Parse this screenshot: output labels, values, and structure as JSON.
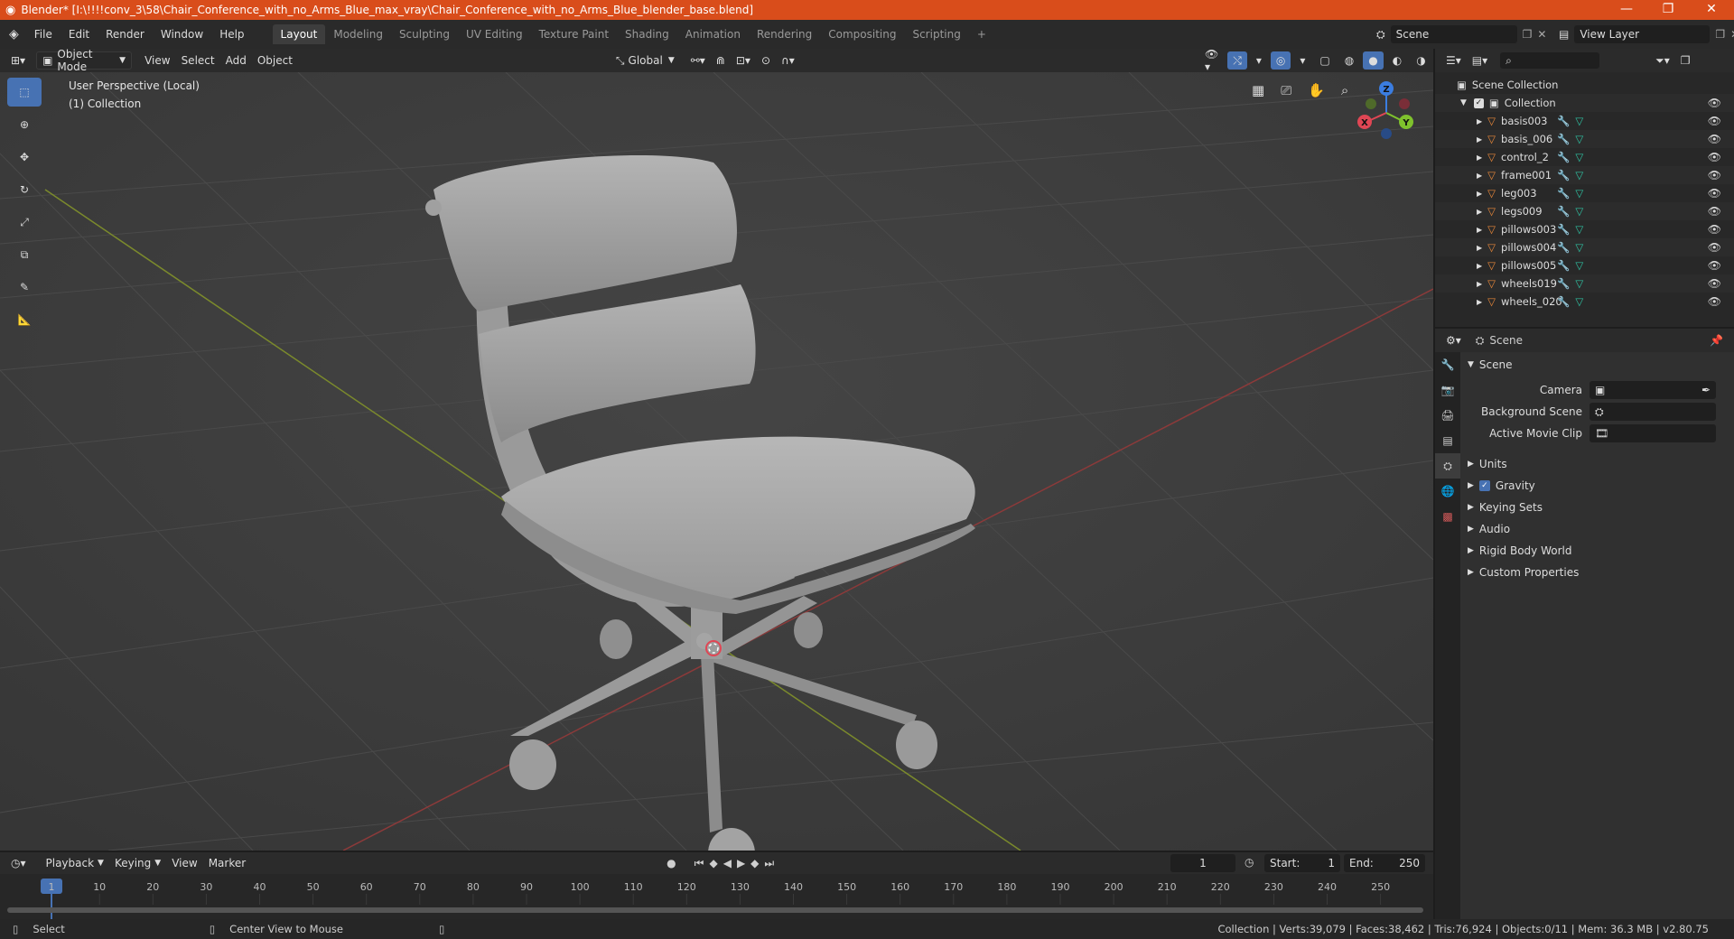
{
  "window": {
    "title": "Blender* [I:\\!!!!conv_3\\58\\Chair_Conference_with_no_Arms_Blue_max_vray\\Chair_Conference_with_no_Arms_Blue_blender_base.blend]",
    "minimize": "—",
    "maximize": "❐",
    "close": "✕"
  },
  "menus": [
    "File",
    "Edit",
    "Render",
    "Window",
    "Help"
  ],
  "workspaces": [
    "Layout",
    "Modeling",
    "Sculpting",
    "UV Editing",
    "Texture Paint",
    "Shading",
    "Animation",
    "Rendering",
    "Compositing",
    "Scripting"
  ],
  "add_workspace": "+",
  "scene_field": "Scene",
  "view_layer_field": "View Layer",
  "viewport_header": {
    "mode": "Object Mode",
    "menus": [
      "View",
      "Select",
      "Add",
      "Object"
    ],
    "orientation": "Global"
  },
  "viewport": {
    "perspective": "User Perspective (Local)",
    "collection": "(1) Collection",
    "gizmo": {
      "z": "Z",
      "y": "Y",
      "x": "X"
    }
  },
  "outliner": {
    "root": "Scene Collection",
    "collection": "Collection",
    "items": [
      "basis003",
      "basis_006",
      "control_2",
      "frame001",
      "leg003",
      "legs009",
      "pillows003",
      "pillows004",
      "pillows005",
      "wheels019",
      "wheels_020"
    ]
  },
  "properties": {
    "header_title": "Scene",
    "panel_title": "Scene",
    "fields": [
      {
        "label": "Camera",
        "value": ""
      },
      {
        "label": "Background Scene",
        "value": ""
      },
      {
        "label": "Active Movie Clip",
        "value": ""
      }
    ],
    "sections": [
      "Units",
      "Gravity",
      "Keying Sets",
      "Audio",
      "Rigid Body World",
      "Custom Properties"
    ],
    "gravity_checked": true
  },
  "timeline": {
    "menus": [
      "Playback",
      "Keying",
      "View",
      "Marker"
    ],
    "current_frame": "1",
    "start_label": "Start:",
    "start": "1",
    "end_label": "End:",
    "end": "250",
    "ruler_ticks": [
      "1",
      "10",
      "20",
      "30",
      "40",
      "50",
      "60",
      "70",
      "80",
      "90",
      "100",
      "110",
      "120",
      "130",
      "140",
      "150",
      "160",
      "170",
      "180",
      "190",
      "200",
      "210",
      "220",
      "230",
      "240",
      "250"
    ]
  },
  "status": {
    "left": "Select",
    "middle": "Center View to Mouse",
    "right": "Collection | Verts:39,079 | Faces:38,462 | Tris:76,924 | Objects:0/11 | Mem: 36.3 MB | v2.80.75"
  },
  "colors": {
    "title_bar": "#d94d1b",
    "active_tool": "#4772b3",
    "mesh_icon": "#e8873a",
    "modifier_icon": "#5aa8e6",
    "data_icon": "#2fc4a4",
    "x_axis": "#e04654",
    "y_axis": "#7fc22d",
    "z_axis": "#3b7de0"
  }
}
